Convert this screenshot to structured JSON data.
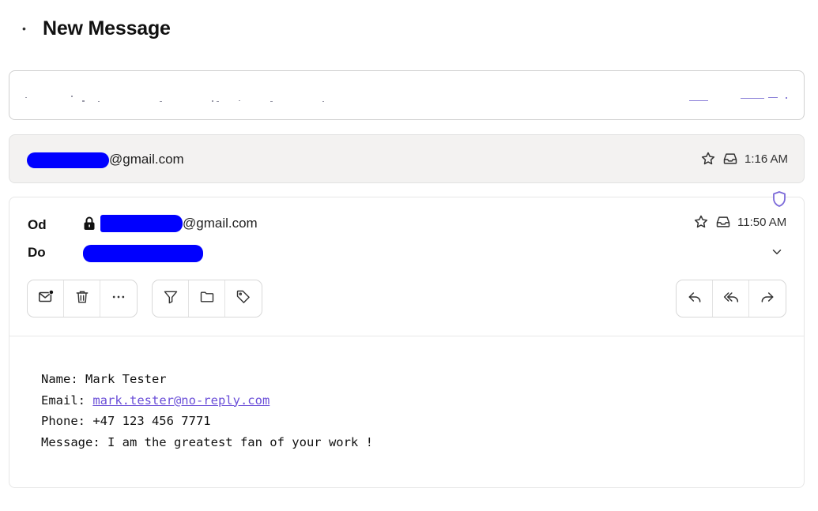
{
  "header": {
    "collapse_icon": "small-dash-icon",
    "title": "New Message"
  },
  "collapsed_message": {
    "sender_domain": "@gmail.com",
    "time": "1:16 AM",
    "icons": [
      "star-icon",
      "inbox-icon"
    ]
  },
  "expanded_message": {
    "from_label": "Od",
    "to_label": "Do",
    "from_domain": "@gmail.com",
    "time": "11:50 AM",
    "icons": [
      "shield-icon",
      "lock-icon",
      "star-icon",
      "inbox-icon",
      "chevron-down-icon"
    ],
    "toolbar_groups": [
      [
        "mark-unread-icon",
        "trash-icon",
        "more-icon"
      ],
      [
        "filter-icon",
        "folder-icon",
        "tag-icon"
      ],
      [
        "reply-icon",
        "reply-all-icon",
        "forward-icon"
      ]
    ],
    "body": {
      "name_line": "Name: Mark Tester",
      "email_prefix": "Email: ",
      "email_link": "mark.tester@no-reply.com",
      "phone_line": "Phone: +47 123 456 7771",
      "message_line": "Message: I am the greatest fan of your work !"
    }
  },
  "colors": {
    "redaction": "#0000ff",
    "accent": "#6b4fd8",
    "collapsed_bg": "#f3f2f1"
  }
}
